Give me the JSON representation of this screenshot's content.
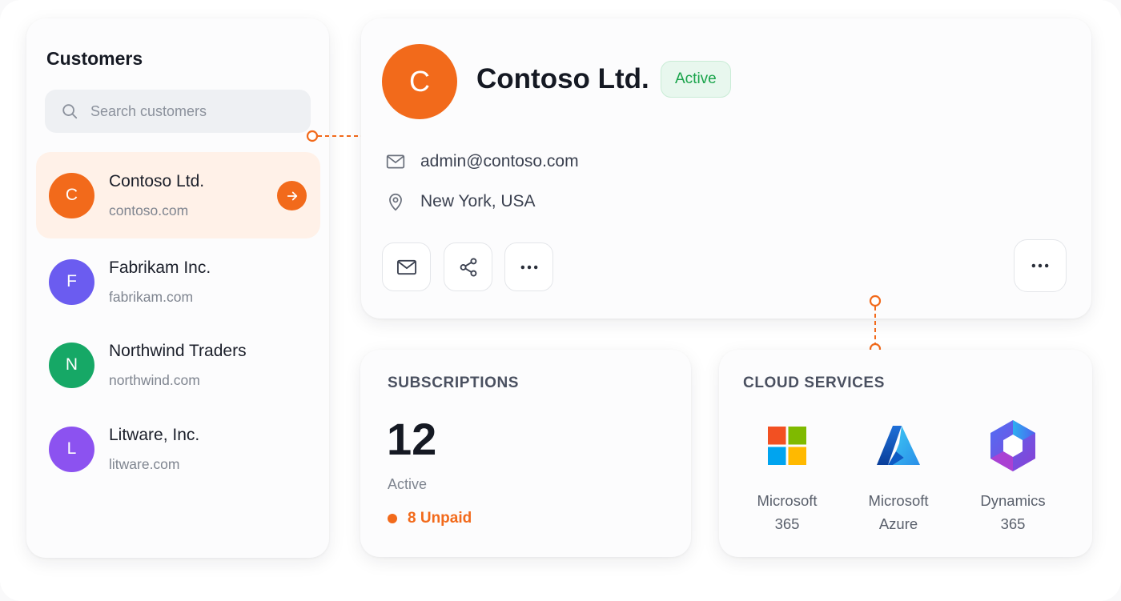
{
  "colors": {
    "accent": "#f26a1b",
    "active_green": "#18a34a",
    "avatar_fabrikam": "#6b5cf0",
    "avatar_northwind": "#16a866",
    "avatar_litware": "#8c52f0"
  },
  "customers": {
    "title": "Customers",
    "search_placeholder": "Search customers",
    "items": [
      {
        "initial": "C",
        "name": "Contoso Ltd.",
        "domain": "contoso.com",
        "selected": true
      },
      {
        "initial": "F",
        "name": "Fabrikam Inc.",
        "domain": "fabrikam.com",
        "selected": false
      },
      {
        "initial": "N",
        "name": "Northwind Traders",
        "domain": "northwind.com",
        "selected": false
      },
      {
        "initial": "L",
        "name": "Litware, Inc.",
        "domain": "litware.com",
        "selected": false
      }
    ]
  },
  "detail": {
    "initial": "C",
    "name": "Contoso Ltd.",
    "status": "Active",
    "email": "admin@contoso.com",
    "location": "New York, USA",
    "actions": [
      "mail-icon",
      "share-icon",
      "more-icon"
    ]
  },
  "subscriptions": {
    "title": "SUBSCRIPTIONS",
    "count": "12",
    "count_label": "Active",
    "unpaid": "8 Unpaid"
  },
  "cloud_services": {
    "title": "CLOUD SERVICES",
    "items": [
      {
        "icon": "microsoft-logo",
        "line1": "Microsoft",
        "line2": "365"
      },
      {
        "icon": "azure-logo",
        "line1": "Microsoft",
        "line2": "Azure"
      },
      {
        "icon": "dynamics-logo",
        "line1": "Dynamics",
        "line2": "365"
      }
    ]
  }
}
